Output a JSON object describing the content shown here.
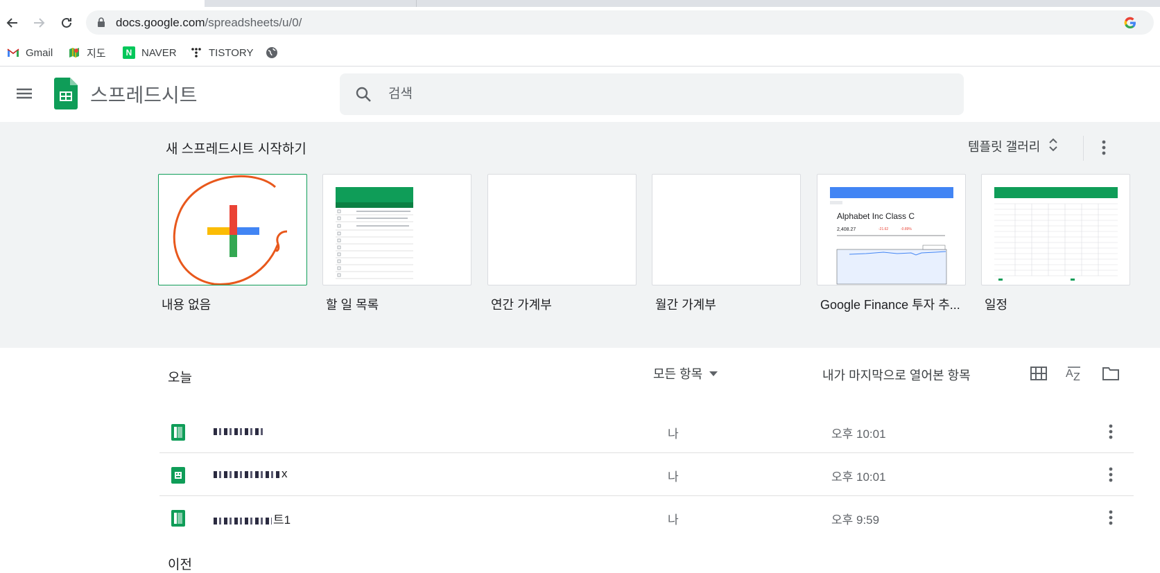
{
  "browser": {
    "url_host": "docs.google.com",
    "url_path": "/spreadsheets/u/0/",
    "bookmarks": [
      {
        "label": "Gmail",
        "icon": "gmail-icon"
      },
      {
        "label": "지도",
        "icon": "maps-icon"
      },
      {
        "label": "NAVER",
        "icon": "naver-icon"
      },
      {
        "label": "TISTORY",
        "icon": "tistory-icon"
      },
      {
        "label": "",
        "icon": "globe-icon"
      }
    ]
  },
  "header": {
    "app_title": "스프레드시트",
    "search_placeholder": "검색"
  },
  "templates": {
    "heading": "새 스프레드시트 시작하기",
    "gallery_label": "템플릿 갤러리",
    "items": [
      {
        "label": "내용 없음"
      },
      {
        "label": "할 일 목록"
      },
      {
        "label": "연간 가계부"
      },
      {
        "label": "월간 가계부"
      },
      {
        "label": "Google Finance 투자 추..."
      },
      {
        "label": "일정"
      }
    ],
    "finance_thumb_title": "Alphabet Inc Class C",
    "finance_thumb_price": "2,408.27",
    "finance_thumb_change": "-21.62",
    "finance_thumb_pct": "-0.89%"
  },
  "files": {
    "section_today": "오늘",
    "owner_filter": "모든 항목",
    "sort_label": "내가 마지막으로 열어본 항목",
    "section_previous": "이전",
    "rows": [
      {
        "name_suffix": "",
        "owner": "나",
        "time": "오후 10:01"
      },
      {
        "name_suffix": "x",
        "owner": "나",
        "time": "오후 10:01"
      },
      {
        "name_suffix": "트1",
        "owner": "나",
        "time": "오후 9:59"
      }
    ]
  },
  "colors": {
    "sheets_green": "#0f9d58",
    "annotation_orange": "#e8581c"
  }
}
